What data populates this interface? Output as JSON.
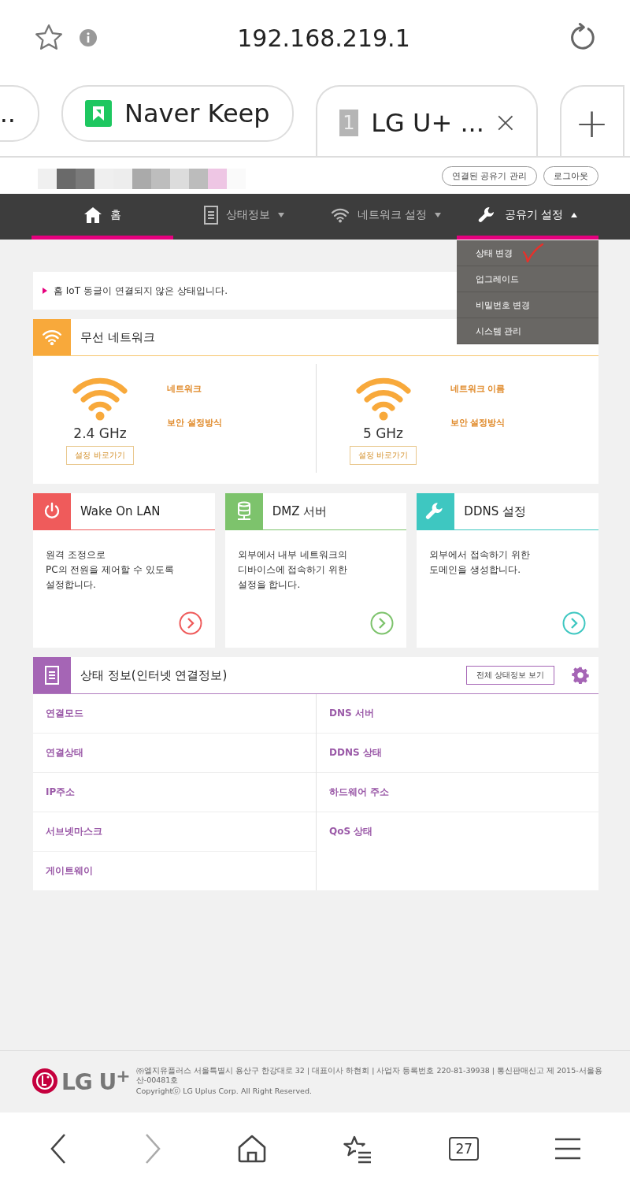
{
  "browser": {
    "address": "192.168.219.1",
    "tabs": [
      {
        "label": "...",
        "kind": "plain",
        "selected": false
      },
      {
        "label": "Naver Keep",
        "kind": "keep",
        "selected": false
      },
      {
        "label": "LG U+ ...",
        "kind": "number",
        "favicon": "1",
        "selected": true
      }
    ],
    "new_tab": "+"
  },
  "header": {
    "buttons": [
      "연결된 공유기 관리",
      "로그아웃"
    ]
  },
  "nav": {
    "items": [
      {
        "label": "홈",
        "kind": "home",
        "selected": true
      },
      {
        "label": "상태정보",
        "kind": "doc",
        "selected": false,
        "expanded": false
      },
      {
        "label": "네트워크 설정",
        "kind": "wifi",
        "selected": false,
        "expanded": false
      },
      {
        "label": "공유기 설정",
        "kind": "wrench",
        "selected": true,
        "expanded": true
      }
    ],
    "dropdown": [
      "상태 변경",
      "업그레이드",
      "비밀번호 변경",
      "시스템 관리"
    ]
  },
  "notice": "홈 IoT 동글이 연결되지 않은 상태입니다.",
  "wireless": {
    "title": "무선 네트워크",
    "bands": [
      {
        "band": "2.4 GHz",
        "button": "설정 바로가기",
        "labels": [
          "네트워크",
          "보안 설정방식"
        ]
      },
      {
        "band": "5 GHz",
        "button": "설정 바로가기",
        "labels": [
          "네트워크 이름",
          "보안 설정방식"
        ]
      }
    ]
  },
  "cards": [
    {
      "title": "Wake On LAN",
      "kind": "power",
      "color": "#ef5b5b",
      "text": "원격 조정으로\nPC의 전원을 제어할 수 있도록\n설정합니다."
    },
    {
      "title": "DMZ 서버",
      "kind": "server",
      "color": "#7dc36c",
      "text": "외부에서 내부 네트워크의\n디바이스에 접속하기 위한\n설정을 합니다."
    },
    {
      "title": "DDNS 설정",
      "kind": "wrench",
      "color": "#3ec7c1",
      "text": "외부에서 접속하기 위한\n도메인을 생성합니다."
    }
  ],
  "status": {
    "title": "상태 정보(인터넷 연결정보)",
    "button": "전체 상태정보 보기",
    "left": [
      "연결모드",
      "연결상태",
      "IP주소",
      "서브넷마스크",
      "게이트웨이"
    ],
    "right": [
      "DNS 서버",
      "DDNS 상태",
      "하드웨어 주소",
      "QoS 상태"
    ]
  },
  "footer": {
    "logo": "LG U",
    "logo_sup": "+",
    "lines": [
      "㈜엘지유플러스 서울특별시 용산구 한강대로 32 | 대표이사 하현회 | 사업자 등록번호 220-81-39938 | 통신판매신고 제 2015-서울용산-00481호",
      "Copyrightⓒ LG Uplus Corp. All Right Reserved."
    ]
  },
  "bottom_bar": {
    "tab_count": "27"
  }
}
